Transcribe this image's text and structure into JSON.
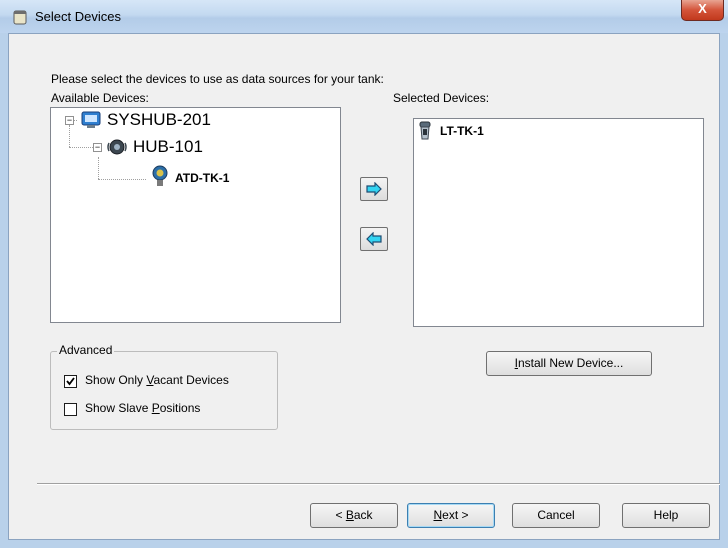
{
  "window": {
    "title": "Select Devices",
    "close_symbol": "X"
  },
  "instructions": "Please select the devices to use as data sources for your tank:",
  "available": {
    "label": "Available Devices:",
    "tree": {
      "root": {
        "label": "SYSHUB-201",
        "icon": "monitor-icon",
        "expanded": true
      },
      "hub": {
        "label": "HUB-101",
        "icon": "hub-icon",
        "expanded": true
      },
      "device": {
        "label": "ATD-TK-1",
        "icon": "sensor-icon"
      }
    }
  },
  "selected": {
    "label": "Selected Devices:",
    "items": [
      {
        "label": "LT-TK-1",
        "icon": "level-transmitter-icon"
      }
    ]
  },
  "move_buttons": {
    "add": "arrow-right-icon",
    "remove": "arrow-left-icon"
  },
  "advanced": {
    "title": "Advanced",
    "show_only_vacant": {
      "pre": "Show Only ",
      "key": "V",
      "post": "acant Devices",
      "checked": true
    },
    "show_slave_positions": {
      "pre": "Show Slave ",
      "key": "P",
      "post": "ositions",
      "checked": false
    }
  },
  "install_button": {
    "key": "I",
    "post": "nstall New Device..."
  },
  "footer": {
    "back": {
      "pre": "< ",
      "key": "B",
      "post": "ack"
    },
    "next": {
      "key": "N",
      "post": "ext >"
    },
    "cancel": "Cancel",
    "help": "Help"
  },
  "colors": {
    "arrow_fill": "#33d4f2",
    "arrow_stroke": "#1f4d73"
  }
}
